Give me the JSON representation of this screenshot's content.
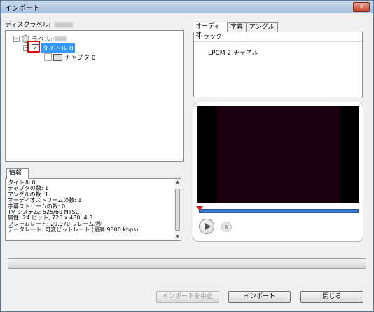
{
  "window": {
    "title": "インポート",
    "close_glyph": "x"
  },
  "disc": {
    "label": "ディスクラベル:"
  },
  "tree": {
    "root_label": "ラベル:",
    "title_label": "タイトル 0",
    "chapter_label": "チャプタ 0"
  },
  "info": {
    "tab": "情報",
    "lines": [
      "タイトル 0",
      "チャプタの数: 1",
      "アングルの数: 1",
      "オーディオストリームの数: 1",
      "字幕ストリームの数: 0",
      "TV システム: 525/60 NTSC",
      "属性: 24 ビット, 720 x 480, 4:3",
      "フレームレート: 29.970 フレーム/秒",
      "データレート: 可変ビットレート (最高 9800 kbps)"
    ]
  },
  "tabs": {
    "audio": "オーディオ",
    "subtitle": "字幕",
    "angle": "アングル"
  },
  "track": {
    "header": "トラック",
    "items": [
      "LPCM 2 チャネル"
    ]
  },
  "player": {
    "progress": 0,
    "play_icon": "play-icon",
    "stop_icon": "stop-icon"
  },
  "buttons": {
    "cancel_import": "インポートを中止",
    "import": "インポート",
    "close": "閉じる"
  },
  "colors": {
    "accent": "#3399ff",
    "highlight": "#e40000",
    "video_bg": "#1a000e"
  }
}
